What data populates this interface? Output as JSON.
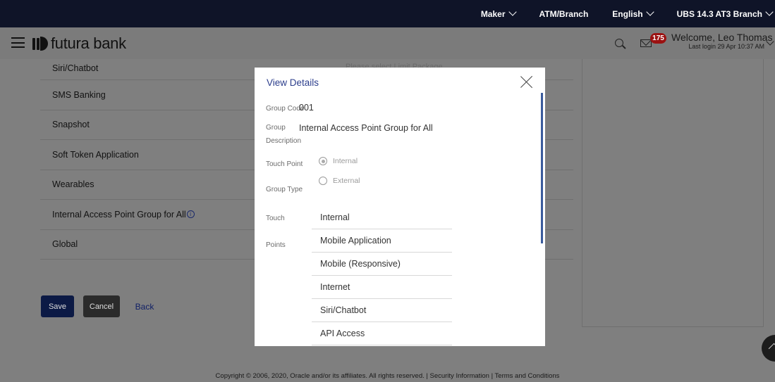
{
  "topbar": {
    "role": "Maker",
    "location": "ATM/Branch",
    "language": "English",
    "branch": "UBS 14.3 AT3 Branch"
  },
  "header": {
    "brand": "futura bank",
    "notification_count": "175",
    "welcome": "Welcome, Leo Thomas",
    "last_login": "Last login 29 Apr 10:37 AM"
  },
  "background": {
    "ghost_text": "Please select Limit Package",
    "rows": [
      {
        "label": "Siri/Chatbot"
      },
      {
        "label": "SMS Banking"
      },
      {
        "label": "Snapshot"
      },
      {
        "label": "Soft Token Application"
      },
      {
        "label": "Wearables"
      },
      {
        "label": "Internal Access Point Group for All"
      },
      {
        "label": "Global"
      }
    ],
    "buttons": {
      "save": "Save",
      "cancel": "Cancel",
      "back": "Back"
    }
  },
  "footer": "Copyright © 2006, 2020, Oracle and/or its affiliates. All rights reserved. | Security Information | Terms and Conditions",
  "modal": {
    "title": "View Details",
    "group_code_label": "Group Code",
    "group_code": "001",
    "group_desc_label_1": "Group",
    "group_desc_label_2": "Description",
    "group_desc": "Internal Access Point Group for All",
    "touch_point_label": "Touch Point",
    "group_type_label": "Group Type",
    "radio_internal": "Internal",
    "radio_external": "External",
    "touch_points_label_1": "Touch",
    "touch_points_label_2": "Points",
    "touch_points": [
      "Internal",
      "Mobile Application",
      "Mobile (Responsive)",
      "Internet",
      "Siri/Chatbot",
      "API Access"
    ]
  }
}
